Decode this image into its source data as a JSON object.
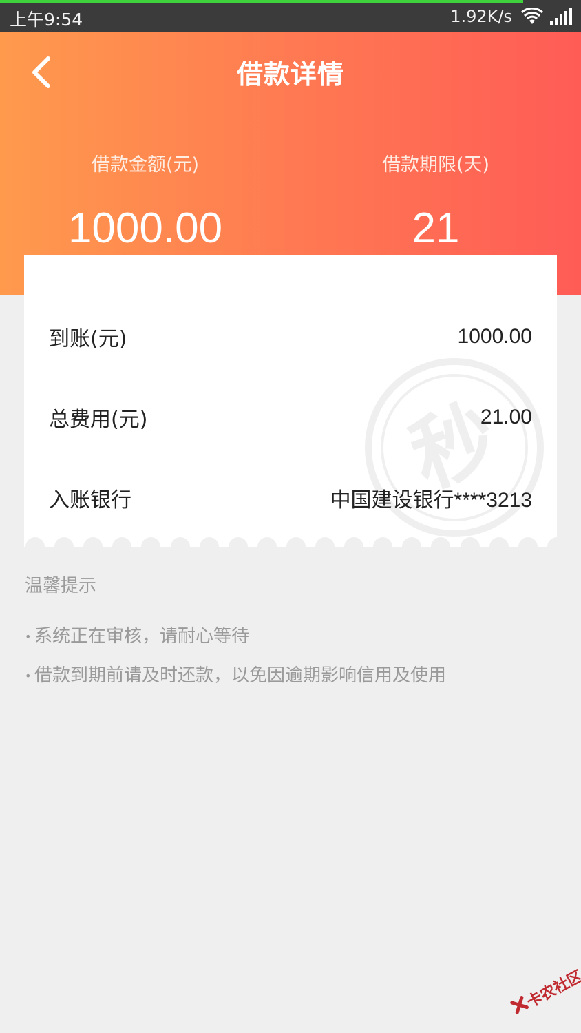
{
  "status_bar": {
    "time": "上午9:54",
    "speed": "1.92K/s"
  },
  "header": {
    "title": "借款详情",
    "amount_label": "借款金额(元)",
    "amount_value": "1000.00",
    "term_label": "借款期限(天)",
    "term_value": "21"
  },
  "details": {
    "received_label": "到账(元)",
    "received_value": "1000.00",
    "fee_label": "总费用(元)",
    "fee_value": "21.00",
    "bank_label": "入账银行",
    "bank_value": "中国建设银行****3213"
  },
  "tips": {
    "title": "温馨提示",
    "items": [
      "系统正在审核，请耐心等待",
      "借款到期前请及时还款，以免因逾期影响信用及使用"
    ]
  },
  "watermark": {
    "text": "卡农社区"
  },
  "colors": {
    "gradient_start": "#ff9a4d",
    "gradient_end": "#ff5c56",
    "status_progress": "#3fd23c",
    "watermark_red": "#c0292f"
  }
}
